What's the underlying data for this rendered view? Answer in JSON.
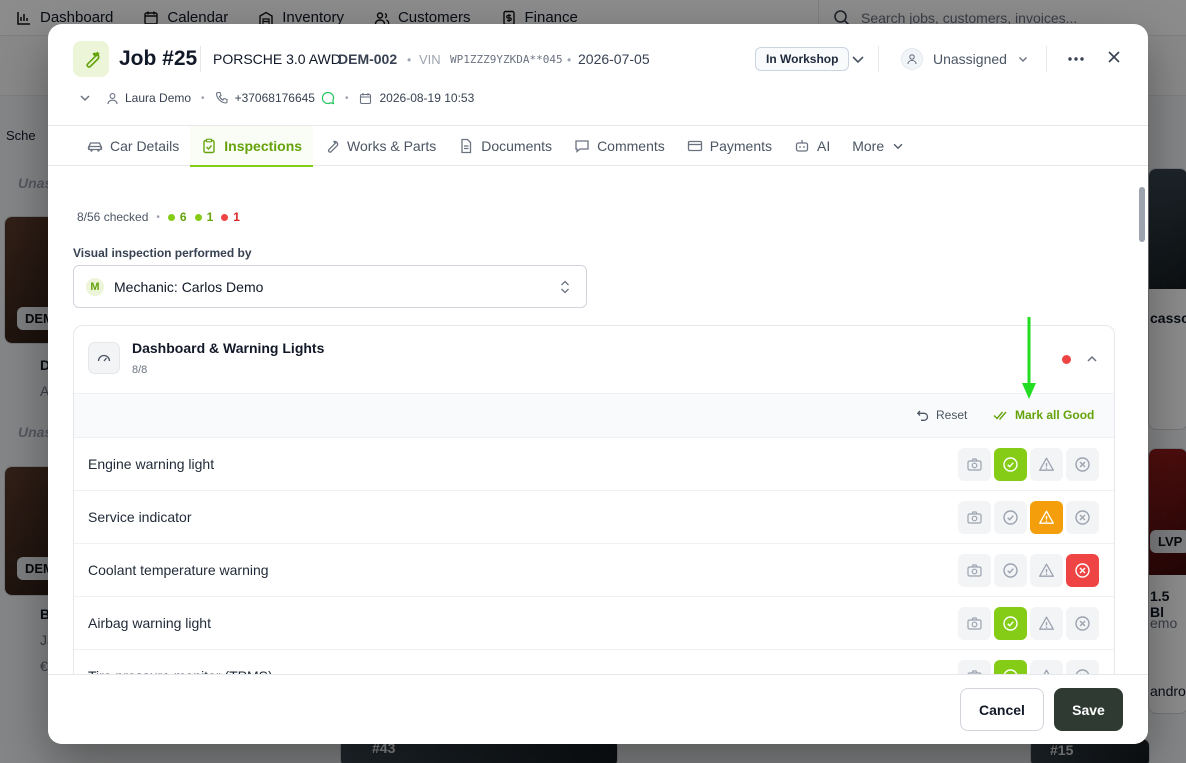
{
  "background": {
    "nav": [
      "Dashboard",
      "Calendar",
      "Inventory",
      "Customers",
      "Finance"
    ],
    "search_placeholder": "Search jobs, customers, invoices...",
    "partial_labels": {
      "sched": "Sche",
      "unas1": "Unas",
      "dem1": "DEM",
      "d1": "D",
      "a1": "A",
      "unas2": "Unas",
      "hash1": "#",
      "dem2": "DEM",
      "b1": "B",
      "ja": "Ja",
      "euro": "€",
      "casso": "casso",
      "lvp": "LVP",
      "b15": "1.5 Bl",
      "emo": "emo",
      "andro": "andro",
      "hash43": "#43",
      "hash15": "#15"
    }
  },
  "header": {
    "job_title": "Job #25",
    "car_name": "PORSCHE 3.0 AWD",
    "plate": "DEM-002",
    "vin_label": "VIN",
    "vin": "WP1ZZZ9YZKDA**045",
    "date": "2026-07-05",
    "status": "In Workshop",
    "assignee": "Unassigned",
    "customer": "Laura Demo",
    "phone": "+37068176645",
    "datetime": "2026-08-19 10:53"
  },
  "tabs": [
    {
      "label": "Car Details"
    },
    {
      "label": "Inspections"
    },
    {
      "label": "Works & Parts"
    },
    {
      "label": "Documents"
    },
    {
      "label": "Comments"
    },
    {
      "label": "Payments"
    },
    {
      "label": "AI"
    },
    {
      "label": "More"
    }
  ],
  "inspection": {
    "checked": "8/56 checked",
    "good_count": "6",
    "warn_count": "1",
    "bad_count": "1",
    "performer_label": "Visual inspection performed by",
    "performer_initial": "M",
    "performer": "Mechanic: Carlos Demo",
    "section": {
      "title": "Dashboard & Warning Lights",
      "count": "8/8",
      "reset_label": "Reset",
      "mark_all_label": "Mark all Good",
      "rows": [
        {
          "label": "Engine warning light",
          "state": "good"
        },
        {
          "label": "Service indicator",
          "state": "warn"
        },
        {
          "label": "Coolant temperature warning",
          "state": "bad"
        },
        {
          "label": "Airbag warning light",
          "state": "good"
        },
        {
          "label": "Tire pressure monitor (TPMS)",
          "state": "good"
        }
      ]
    }
  },
  "colors": {
    "accent": "#84cc16",
    "warn": "#f59e0b",
    "bad": "#ef4444",
    "annotation_arrow": "#22dd22"
  },
  "footer": {
    "cancel_label": "Cancel",
    "save_label": "Save"
  }
}
